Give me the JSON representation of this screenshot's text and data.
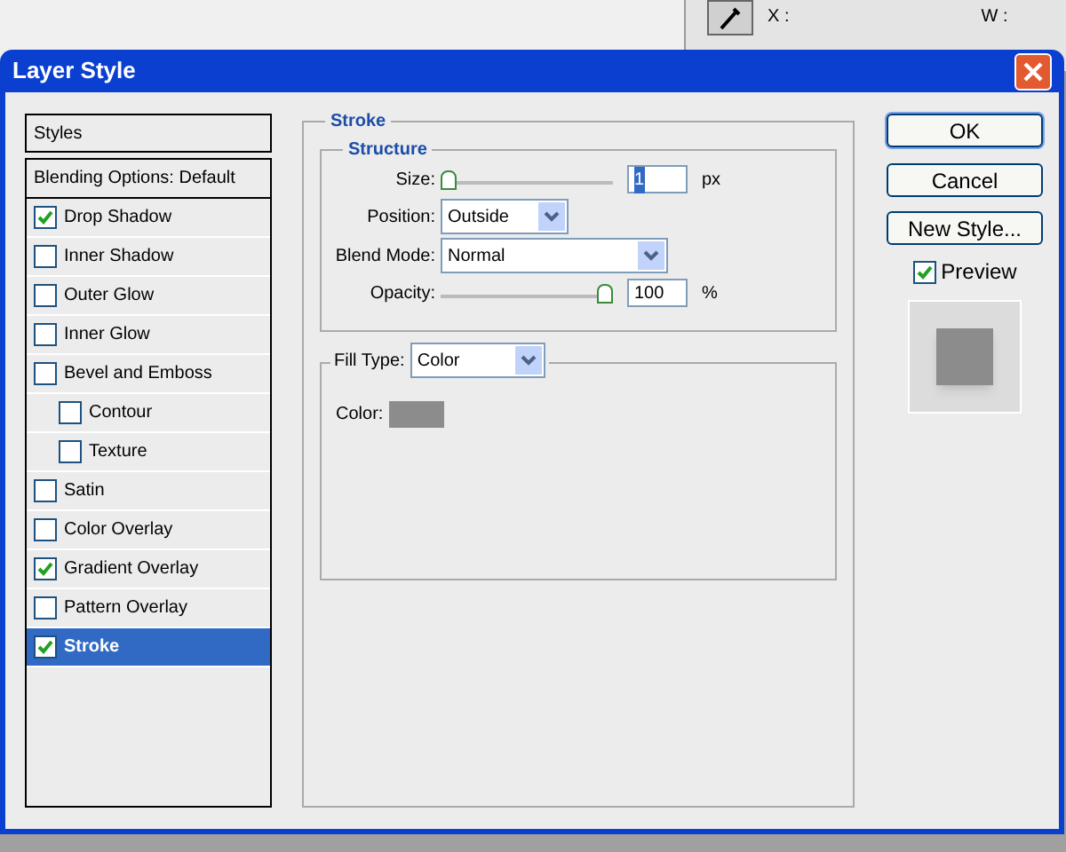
{
  "window": {
    "title": "Layer Style"
  },
  "background_panel": {
    "x_label": "X :",
    "w_label": "W :"
  },
  "styles_list": {
    "header": "Styles",
    "items": [
      {
        "label": "Blending Options: Default",
        "kind": "plain",
        "selected": false
      },
      {
        "label": "Drop Shadow",
        "kind": "check",
        "checked": true,
        "selected": false
      },
      {
        "label": "Inner Shadow",
        "kind": "check",
        "checked": false,
        "selected": false
      },
      {
        "label": "Outer Glow",
        "kind": "check",
        "checked": false,
        "selected": false
      },
      {
        "label": "Inner Glow",
        "kind": "check",
        "checked": false,
        "selected": false
      },
      {
        "label": "Bevel and Emboss",
        "kind": "check",
        "checked": false,
        "selected": false,
        "children": [
          {
            "label": "Contour",
            "kind": "check",
            "checked": false,
            "selected": false
          },
          {
            "label": "Texture",
            "kind": "check",
            "checked": false,
            "selected": false
          }
        ]
      },
      {
        "label": "Satin",
        "kind": "check",
        "checked": false,
        "selected": false
      },
      {
        "label": "Color Overlay",
        "kind": "check",
        "checked": false,
        "selected": false
      },
      {
        "label": "Gradient Overlay",
        "kind": "check",
        "checked": true,
        "selected": false
      },
      {
        "label": "Pattern Overlay",
        "kind": "check",
        "checked": false,
        "selected": false
      },
      {
        "label": "Stroke",
        "kind": "check",
        "checked": true,
        "selected": true
      }
    ]
  },
  "stroke": {
    "title": "Stroke",
    "structure": {
      "title": "Structure",
      "size": {
        "label": "Size:",
        "level": 0,
        "value": "1",
        "value_selected": true,
        "unit": "px"
      },
      "position": {
        "label": "Position:",
        "value": "Outside"
      },
      "blend_mode": {
        "label": "Blend Mode:",
        "value": "Normal"
      },
      "opacity": {
        "label": "Opacity:",
        "level": 1,
        "value": "100",
        "unit": "%"
      }
    },
    "fill": {
      "label": "Fill Type:",
      "value": "Color",
      "color_label": "Color:",
      "color": "#8c8c8c"
    }
  },
  "buttons": [
    "OK",
    "Cancel",
    "New Style..."
  ],
  "preview": {
    "label": "Preview",
    "checked": true
  }
}
